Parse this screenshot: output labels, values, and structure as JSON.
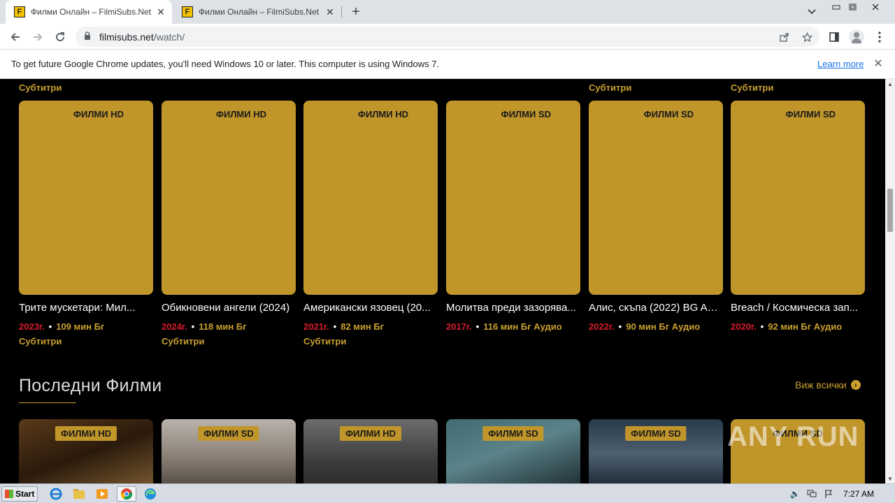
{
  "browser": {
    "tabs": [
      {
        "title": "Филми Онлайн – FilmiSubs.Net",
        "favicon": "F",
        "active": true
      },
      {
        "title": "Филми Онлайн – FilmiSubs.Net",
        "favicon": "F",
        "active": false
      }
    ],
    "url_domain": "filmisubs.net",
    "url_path": "/watch/"
  },
  "infobar": {
    "message": "To get future Google Chrome updates, you'll need Windows 10 or later. This computer is using Windows 7.",
    "link": "Learn more"
  },
  "prev_row_subs": [
    "Субтитри",
    "Субтитри",
    "Субтитри"
  ],
  "movies": [
    {
      "badge": "ФИЛМИ HD",
      "title": "Трите мускетари: Мил...",
      "year": "2023г.",
      "duration": "109 мин Бг",
      "extra": "Субтитри"
    },
    {
      "badge": "ФИЛМИ HD",
      "title": "Обикновени ангели (2024)",
      "year": "2024г.",
      "duration": "118 мин Бг",
      "extra": "Субтитри"
    },
    {
      "badge": "ФИЛМИ HD",
      "title": "Американски язовец (20...",
      "year": "2021г.",
      "duration": "82 мин Бг",
      "extra": "Субтитри"
    },
    {
      "badge": "ФИЛМИ SD",
      "title": "Молитва преди зазорява...",
      "year": "2017г.",
      "duration": "116 мин Бг Аудио",
      "extra": ""
    },
    {
      "badge": "ФИЛМИ SD",
      "title": "Алис, скъпа (2022) BG AU...",
      "year": "2022г.",
      "duration": "90 мин Бг Аудио",
      "extra": ""
    },
    {
      "badge": "ФИЛМИ SD",
      "title": "Breach / Космическа зап...",
      "year": "2020г.",
      "duration": "92 мин Бг Аудио",
      "extra": ""
    }
  ],
  "latest": {
    "title": "Последни Филми",
    "view_all": "Виж всички",
    "cards": [
      {
        "badge": "ФИЛМИ HD"
      },
      {
        "badge": "ФИЛМИ SD"
      },
      {
        "badge": "ФИЛМИ HD"
      },
      {
        "badge": "ФИЛМИ SD"
      },
      {
        "badge": "ФИЛМИ SD"
      },
      {
        "badge": "ФИЛМИ SD"
      }
    ]
  },
  "watermark": "ANY RUN",
  "taskbar": {
    "start": "Start",
    "clock": "7:27 AM"
  },
  "colors": {
    "poster_gold": "#c0962b",
    "accent_gold": "#c9a02e",
    "year_red": "#d81a2d"
  }
}
